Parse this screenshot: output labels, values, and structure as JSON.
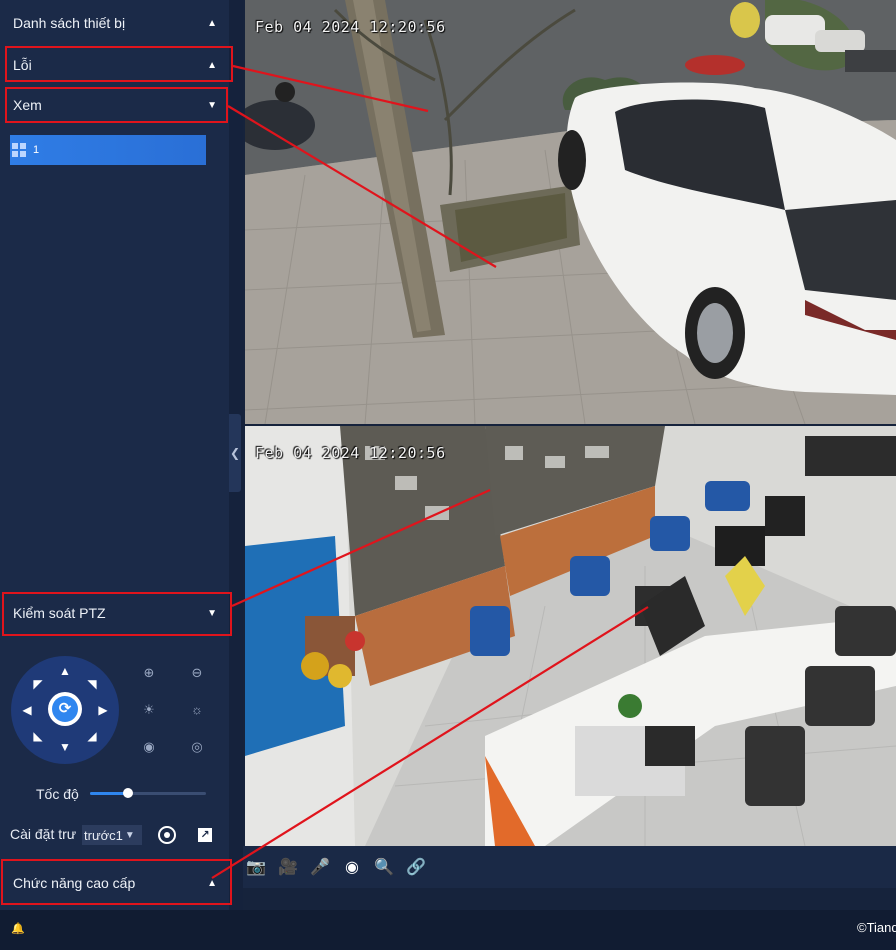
{
  "sidebar": {
    "device_list_title": "Danh sách thiết bị",
    "error_title": "Lỗi",
    "view_title": "Xem",
    "device_item_label": "1",
    "ptz_title": "Kiểm soát PTZ",
    "speed_label": "Tốc độ",
    "speed_level": 0.33,
    "preset_label": "Cài đặt trư",
    "preset_value": "trước1",
    "advanced_title": "Chức năng cao cấp"
  },
  "video": {
    "top_timestamp": "Feb 04 2024 12:20:56",
    "bottom_timestamp": "Feb 04 2024 12:20:56"
  },
  "toolbar": {
    "icons": [
      "camera-icon",
      "video-record-icon",
      "microphone-icon",
      "webcam-icon",
      "zoom-icon",
      "link-icon"
    ]
  },
  "footer": {
    "copyright": "©Tiand"
  },
  "colors": {
    "annotation": "#e0141c",
    "accent": "#2f86ef",
    "sidebar_bg": "#1b2a48"
  }
}
